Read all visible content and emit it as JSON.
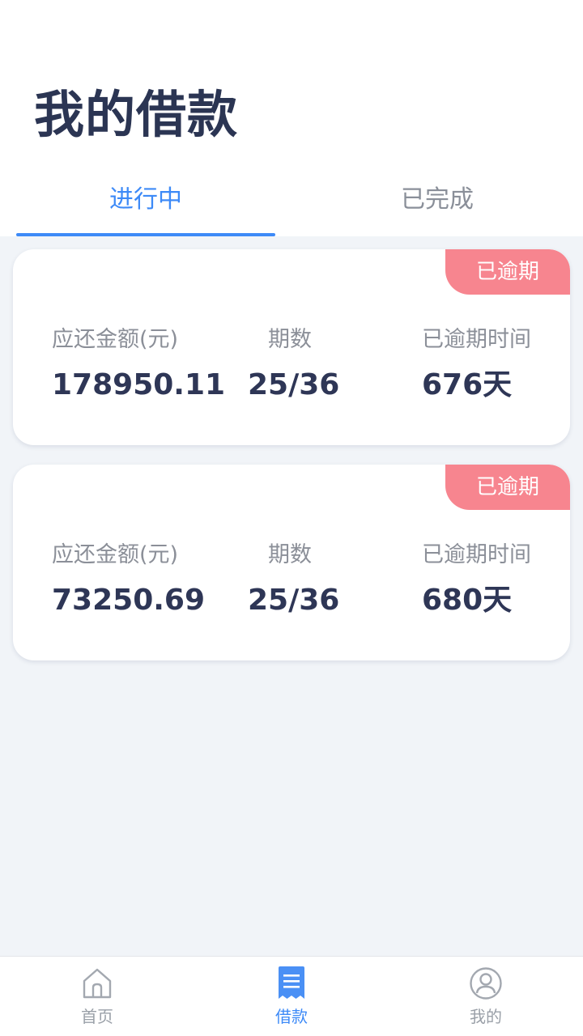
{
  "header": {
    "title": "我的借款"
  },
  "tabs": [
    {
      "label": "进行中",
      "active": true
    },
    {
      "label": "已完成",
      "active": false
    }
  ],
  "labels": {
    "amount": "应还金额(元)",
    "periods": "期数",
    "overdue_time": "已逾期时间"
  },
  "loans": [
    {
      "status": "已逾期",
      "amount": "178950.11",
      "periods": "25/36",
      "overdue_days": "676天"
    },
    {
      "status": "已逾期",
      "amount": "73250.69",
      "periods": "25/36",
      "overdue_days": "680天"
    }
  ],
  "bottom_nav": [
    {
      "label": "首页",
      "icon": "home-icon",
      "active": false
    },
    {
      "label": "借款",
      "icon": "bill-icon",
      "active": true
    },
    {
      "label": "我的",
      "icon": "user-icon",
      "active": false
    }
  ],
  "colors": {
    "accent": "#3d8af7",
    "badge": "#f7858f",
    "title": "#2b3553",
    "background": "#f1f4f8"
  }
}
